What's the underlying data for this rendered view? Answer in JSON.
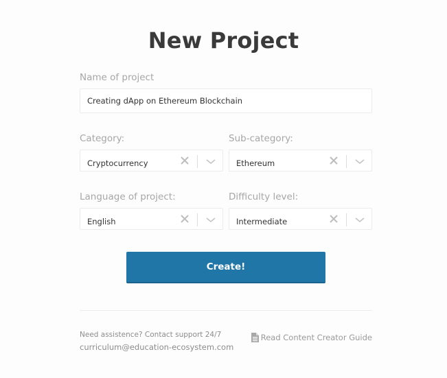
{
  "title": "New Project",
  "name_field": {
    "label": "Name of project",
    "value": "Creating dApp on Ethereum Blockchain"
  },
  "category": {
    "label": "Category:",
    "value": "Cryptocurrency"
  },
  "subcategory": {
    "label": "Sub-category:",
    "value": "Ethereum"
  },
  "language": {
    "label": "Language of project:",
    "value": "English"
  },
  "difficulty": {
    "label": "Difficulty level:",
    "value": "Intermediate"
  },
  "icons": {
    "clear": "close-icon",
    "dropdown": "chevron-down-icon",
    "guide": "document-icon"
  },
  "create_button": "Create!",
  "footer": {
    "support_text": "Need assistence? Contact support 24/7",
    "support_email": "curriculum@education-ecosystem.com",
    "guide_link": "Read Content Creator Guide"
  },
  "colors": {
    "primary": "#2176a8",
    "title": "#3a3a3a",
    "label": "#a6a6a6"
  }
}
